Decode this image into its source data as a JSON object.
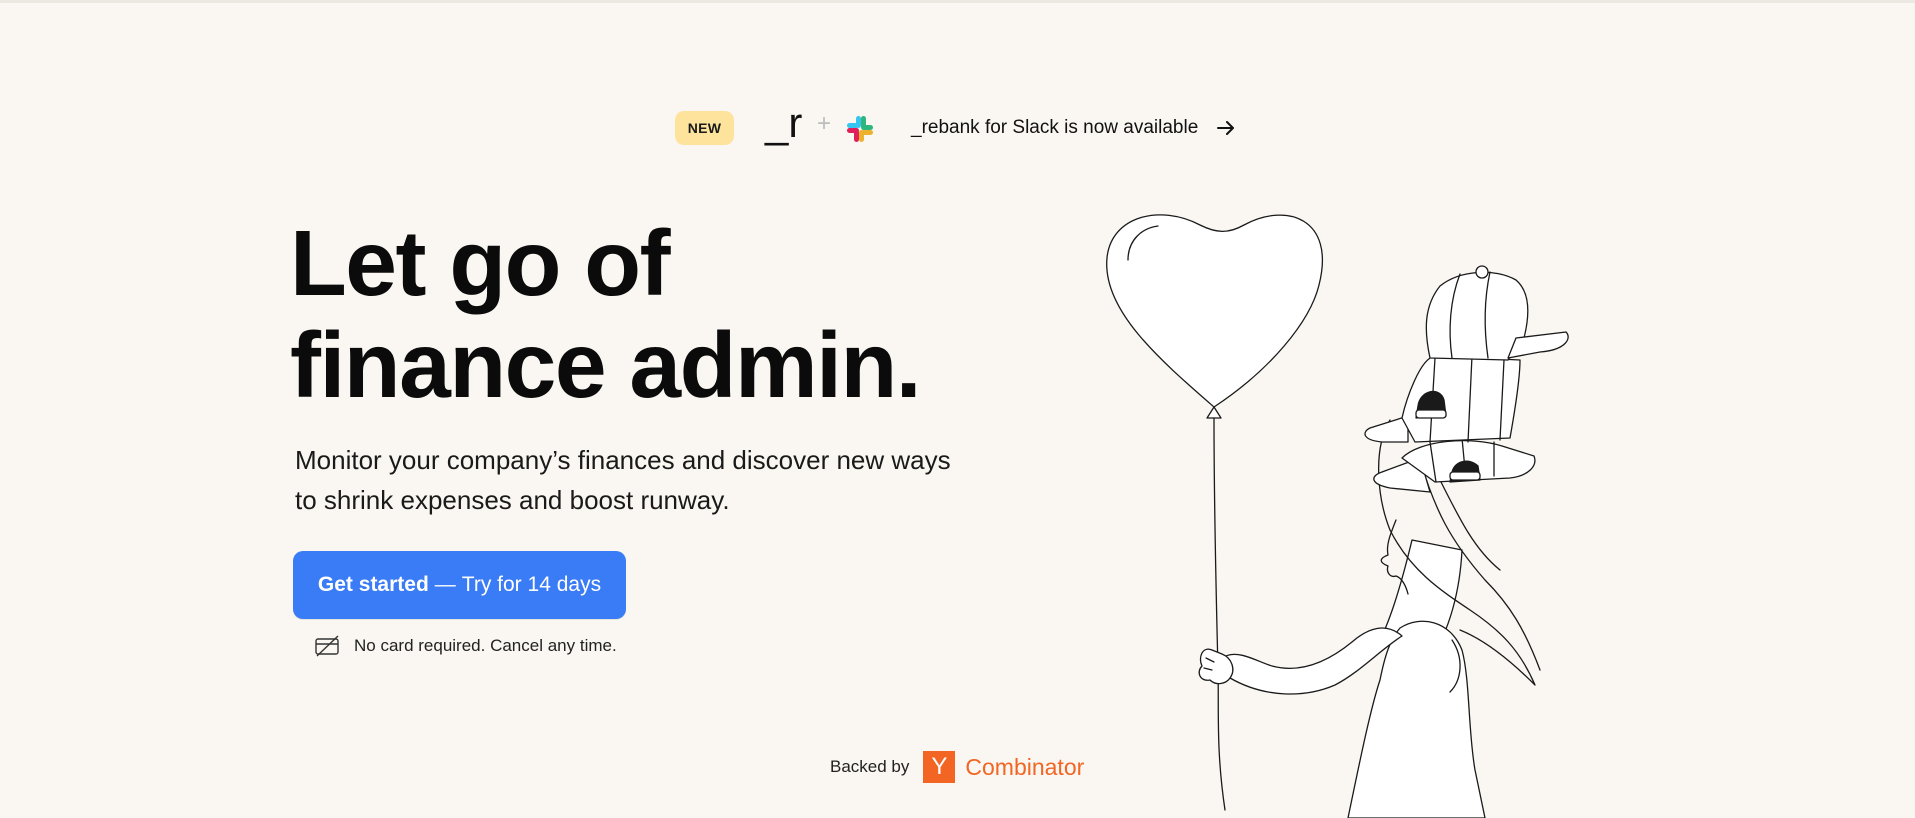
{
  "announcement": {
    "badge": "NEW",
    "brand_mark": "_r",
    "plus": "+",
    "integration_icon": "slack-icon",
    "text": "_rebank for Slack is now available",
    "arrow_icon": "arrow-right-icon"
  },
  "hero": {
    "headline_line1": "Let go of",
    "headline_line2": "finance admin.",
    "sub_line1": "Monitor your company’s finances and discover new ways",
    "sub_line2": "to shrink expenses and boost runway."
  },
  "cta": {
    "label_strong": "Get started",
    "separator": "—",
    "label_rest": "Try for 14 days"
  },
  "note": {
    "icon": "no-card-icon",
    "text": "No card required. Cancel any time."
  },
  "backed": {
    "label": "Backed by",
    "logo_letter": "Y",
    "logo_word": "Combinator"
  },
  "colors": {
    "background": "#faf7f2",
    "badge": "#fde39c",
    "cta": "#3a7bf6",
    "yc_orange": "#f26522"
  }
}
